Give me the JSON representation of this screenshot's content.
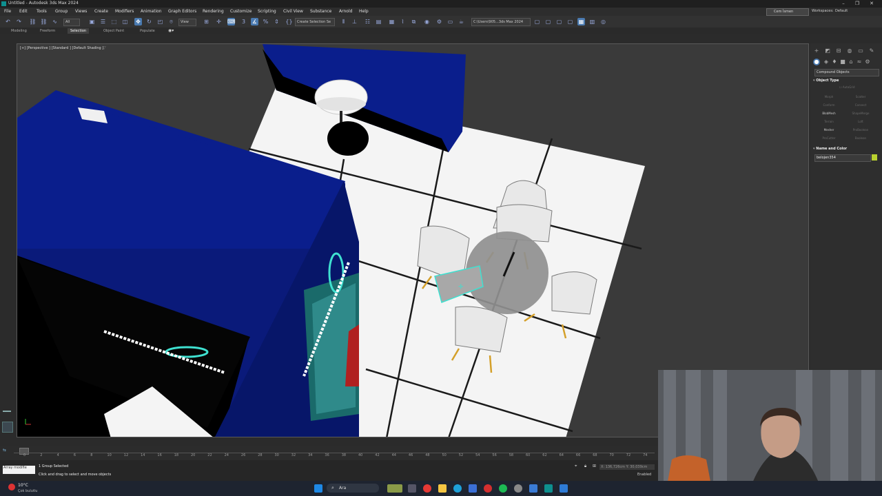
{
  "window": {
    "title": "Untitled - Autodesk 3ds Max 2024"
  },
  "menu": [
    "File",
    "Edit",
    "Tools",
    "Group",
    "Views",
    "Create",
    "Modifiers",
    "Animation",
    "Graph Editors",
    "Rendering",
    "Customize",
    "Scripting",
    "Civil View",
    "Substance",
    "Arnold",
    "Help"
  ],
  "account": {
    "user": "Cem İsmen",
    "workspaces_label": "Workspaces:",
    "workspace": "Default"
  },
  "toolbar": {
    "selection_filter": "All",
    "named_selection": "Create Selection Se",
    "view_dropdown": "View",
    "project_path": "C:\\Users\\905...3ds Max 2024"
  },
  "ribbon_tabs": [
    {
      "label": "Modeling",
      "active": false
    },
    {
      "label": "Freeform",
      "active": false
    },
    {
      "label": "Selection",
      "active": true
    },
    {
      "label": "Object Paint",
      "active": false
    },
    {
      "label": "Populate",
      "active": false
    }
  ],
  "viewport": {
    "label": "[+] [Perspective ] [Standard ] [Default Shading ]"
  },
  "command_panel": {
    "category": "Compound Objects",
    "object_type_title": "Object Type",
    "autogrid": "AutoGrid",
    "buttons": [
      {
        "label": "Morph",
        "enabled": false
      },
      {
        "label": "Scatter",
        "enabled": false
      },
      {
        "label": "Conform",
        "enabled": false
      },
      {
        "label": "Connect",
        "enabled": false
      },
      {
        "label": "BlobMesh",
        "enabled": true
      },
      {
        "label": "ShapeMerge",
        "enabled": false
      },
      {
        "label": "Terrain",
        "enabled": false
      },
      {
        "label": "Loft",
        "enabled": false
      },
      {
        "label": "Mesher",
        "enabled": true
      },
      {
        "label": "ProBoolean",
        "enabled": false
      },
      {
        "label": "ProCutter",
        "enabled": false
      },
      {
        "label": "Boolean",
        "enabled": false
      }
    ],
    "name_color_title": "Name and Color",
    "object_name": "belojen354",
    "object_color": "#b9d12f"
  },
  "timeline": {
    "ticks": [
      "0",
      "2",
      "4",
      "6",
      "8",
      "10",
      "12",
      "14",
      "16",
      "18",
      "20",
      "22",
      "24",
      "26",
      "28",
      "30",
      "32",
      "34",
      "36",
      "38",
      "40",
      "42",
      "44",
      "46",
      "48",
      "50",
      "52",
      "54",
      "56",
      "58",
      "60",
      "62",
      "64",
      "66",
      "68",
      "70",
      "72",
      "74"
    ]
  },
  "status": {
    "maxscript": "Array modifie",
    "selection": "1 Group Selected",
    "prompt": "Click and drag to select and move objects",
    "coords": "X: 136,726cm  Y: 30,039cm",
    "enabled": "Enabled"
  },
  "taskbar": {
    "temperature": "10°C",
    "weather": "Çok bulutlu",
    "search": "Ara"
  },
  "colors": {
    "booth_blue": "#0a1e8c",
    "viewport_bg": "#3a3a3a",
    "selection_cyan": "#3fe0d0"
  }
}
